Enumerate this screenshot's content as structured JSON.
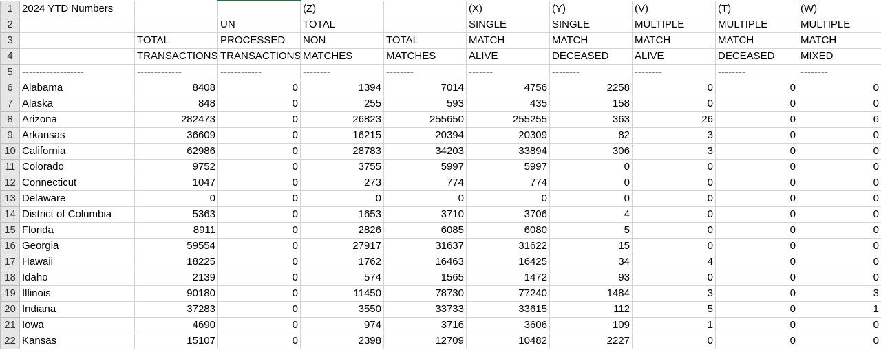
{
  "sheet": {
    "header_rows": [
      [
        "2024 YTD Numbers",
        "",
        "",
        "(Z)",
        "",
        "(X)",
        "(Y)",
        "(V)",
        "(T)",
        "(W)"
      ],
      [
        "",
        "",
        "UN",
        "TOTAL",
        "",
        "SINGLE",
        "SINGLE",
        "MULTIPLE",
        "MULTIPLE",
        "MULTIPLE"
      ],
      [
        "",
        "TOTAL",
        "PROCESSED",
        "NON",
        "TOTAL",
        "MATCH",
        "MATCH",
        "MATCH",
        "MATCH",
        "MATCH"
      ],
      [
        "",
        "TRANSACTIONS",
        "TRANSACTIONS",
        "MATCHES",
        "MATCHES",
        "ALIVE",
        "DECEASED",
        "ALIVE",
        "DECEASED",
        "MIXED"
      ],
      [
        "------------------",
        "-------------",
        "------------",
        "--------",
        "--------",
        "-------",
        "--------",
        "--------",
        "--------",
        "--------"
      ]
    ],
    "data_rows": [
      [
        "Alabama",
        "8408",
        "0",
        "1394",
        "7014",
        "4756",
        "2258",
        "0",
        "0",
        "0"
      ],
      [
        "Alaska",
        "848",
        "0",
        "255",
        "593",
        "435",
        "158",
        "0",
        "0",
        "0"
      ],
      [
        "Arizona",
        "282473",
        "0",
        "26823",
        "255650",
        "255255",
        "363",
        "26",
        "0",
        "6"
      ],
      [
        "Arkansas",
        "36609",
        "0",
        "16215",
        "20394",
        "20309",
        "82",
        "3",
        "0",
        "0"
      ],
      [
        "California",
        "62986",
        "0",
        "28783",
        "34203",
        "33894",
        "306",
        "3",
        "0",
        "0"
      ],
      [
        "Colorado",
        "9752",
        "0",
        "3755",
        "5997",
        "5997",
        "0",
        "0",
        "0",
        "0"
      ],
      [
        "Connecticut",
        "1047",
        "0",
        "273",
        "774",
        "774",
        "0",
        "0",
        "0",
        "0"
      ],
      [
        "Delaware",
        "0",
        "0",
        "0",
        "0",
        "0",
        "0",
        "0",
        "0",
        "0"
      ],
      [
        "District of Columbia",
        "5363",
        "0",
        "1653",
        "3710",
        "3706",
        "4",
        "0",
        "0",
        "0"
      ],
      [
        "Florida",
        "8911",
        "0",
        "2826",
        "6085",
        "6080",
        "5",
        "0",
        "0",
        "0"
      ],
      [
        "Georgia",
        "59554",
        "0",
        "27917",
        "31637",
        "31622",
        "15",
        "0",
        "0",
        "0"
      ],
      [
        "Hawaii",
        "18225",
        "0",
        "1762",
        "16463",
        "16425",
        "34",
        "4",
        "0",
        "0"
      ],
      [
        "Idaho",
        "2139",
        "0",
        "574",
        "1565",
        "1472",
        "93",
        "0",
        "0",
        "0"
      ],
      [
        "Illinois",
        "90180",
        "0",
        "11450",
        "78730",
        "77240",
        "1484",
        "3",
        "0",
        "3"
      ],
      [
        "Indiana",
        "37283",
        "0",
        "3550",
        "33733",
        "33615",
        "112",
        "5",
        "0",
        "1"
      ],
      [
        "Iowa",
        "4690",
        "0",
        "974",
        "3716",
        "3606",
        "109",
        "1",
        "0",
        "0"
      ],
      [
        "Kansas",
        "15107",
        "0",
        "2398",
        "12709",
        "10482",
        "2227",
        "0",
        "0",
        "0"
      ]
    ]
  }
}
